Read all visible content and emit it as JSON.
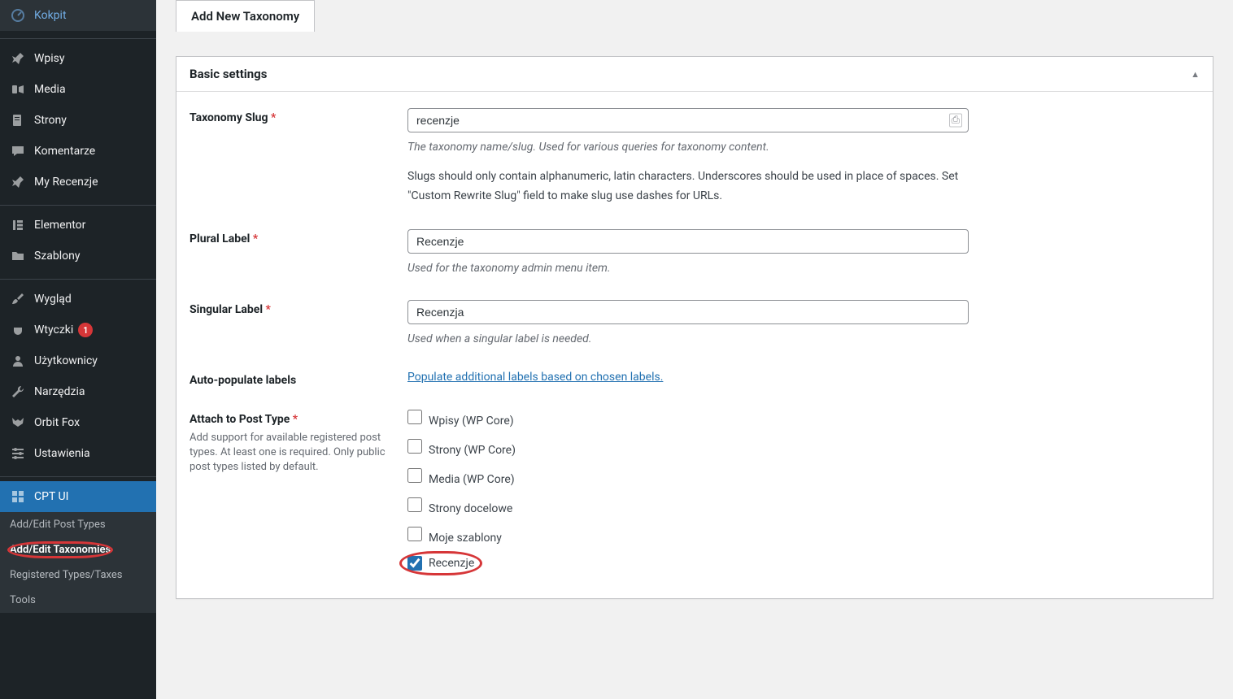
{
  "sidebar": {
    "items": [
      {
        "icon": "dashboard",
        "label": "Kokpit"
      },
      {
        "icon": "pin",
        "label": "Wpisy"
      },
      {
        "icon": "media",
        "label": "Media"
      },
      {
        "icon": "page",
        "label": "Strony"
      },
      {
        "icon": "comment",
        "label": "Komentarze"
      },
      {
        "icon": "pin",
        "label": "My Recenzje"
      },
      {
        "icon": "elementor",
        "label": "Elementor"
      },
      {
        "icon": "folder",
        "label": "Szablony"
      },
      {
        "icon": "brush",
        "label": "Wygląd"
      },
      {
        "icon": "plugin",
        "label": "Wtyczki",
        "badge": "1"
      },
      {
        "icon": "user",
        "label": "Użytkownicy"
      },
      {
        "icon": "wrench",
        "label": "Narzędzia"
      },
      {
        "icon": "fox",
        "label": "Orbit Fox"
      },
      {
        "icon": "settings",
        "label": "Ustawienia"
      },
      {
        "icon": "cptui",
        "label": "CPT UI",
        "current": true
      }
    ],
    "submenu": [
      {
        "label": "Add/Edit Post Types"
      },
      {
        "label": "Add/Edit Taxonomies",
        "current": true,
        "annot": true
      },
      {
        "label": "Registered Types/Taxes"
      },
      {
        "label": "Tools"
      }
    ]
  },
  "tab": {
    "label": "Add New Taxonomy"
  },
  "panel": {
    "title": "Basic settings"
  },
  "fields": {
    "slug": {
      "label": "Taxonomy Slug",
      "value": "recenzje",
      "desc": "The taxonomy name/slug. Used for various queries for taxonomy content.",
      "note": "Slugs should only contain alphanumeric, latin characters. Underscores should be used in place of spaces. Set \"Custom Rewrite Slug\" field to make slug use dashes for URLs."
    },
    "plural": {
      "label": "Plural Label",
      "value": "Recenzje",
      "desc": "Used for the taxonomy admin menu item."
    },
    "singular": {
      "label": "Singular Label",
      "value": "Recenzja",
      "desc": "Used when a singular label is needed."
    },
    "autopop": {
      "label": "Auto-populate labels",
      "link": "Populate additional labels based on chosen labels."
    },
    "attach": {
      "label": "Attach to Post Type",
      "sublabel": "Add support for available registered post types. At least one is required. Only public post types listed by default.",
      "options": [
        {
          "label": "Wpisy (WP Core)",
          "checked": false
        },
        {
          "label": "Strony (WP Core)",
          "checked": false
        },
        {
          "label": "Media (WP Core)",
          "checked": false
        },
        {
          "label": "Strony docelowe",
          "checked": false
        },
        {
          "label": "Moje szablony",
          "checked": false
        },
        {
          "label": "Recenzje",
          "checked": true,
          "annot": true
        }
      ]
    }
  }
}
